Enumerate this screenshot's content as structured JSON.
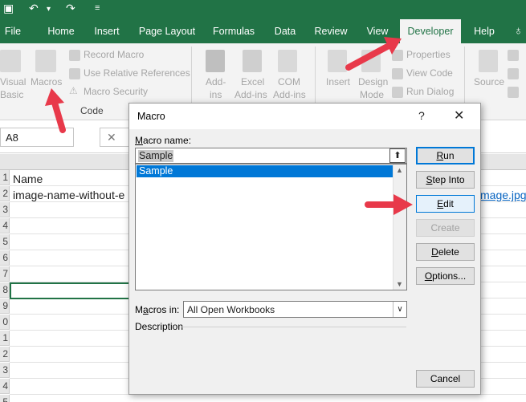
{
  "qat": {
    "undo_icon": "undo-icon",
    "redo_icon": "redo-icon"
  },
  "tabs": [
    "File",
    "Home",
    "Insert",
    "Page Layout",
    "Formulas",
    "Data",
    "Review",
    "View",
    "Developer",
    "Help"
  ],
  "ribbon": {
    "visual_basic": [
      "Visual",
      "Basic"
    ],
    "macros": "Macros",
    "record_macro": "Record Macro",
    "use_relative": "Use Relative References",
    "macro_security": "Macro Security",
    "code_group": "Code",
    "addins": [
      "Add-",
      "ins"
    ],
    "excel_addins": [
      "Excel",
      "Add-ins"
    ],
    "com_addins": [
      "COM",
      "Add-ins"
    ],
    "insert": "Insert",
    "design_mode": [
      "Design",
      "Mode"
    ],
    "properties": "Properties",
    "view_code": "View Code",
    "run_dialog": "Run Dialog",
    "source": "Source"
  },
  "formula_bar": {
    "name_box": "A8",
    "cancel": "✕"
  },
  "grid": {
    "header_name": "Name",
    "row2_text": "image-name-without-e",
    "row2_right": "mage.jpg",
    "row_numbers": [
      "",
      "1",
      "2",
      "3",
      "4",
      "5",
      "6",
      "7",
      "8",
      "9",
      "0",
      "1",
      "2",
      "3",
      "4",
      "5"
    ]
  },
  "dialog": {
    "title": "Macro",
    "help": "?",
    "close": "✕",
    "macro_name_label": "Macro name:",
    "macro_name_value": "Sample",
    "list_items": [
      "Sample"
    ],
    "macros_in_label": "Macros in:",
    "macros_in_value": "All Open Workbooks",
    "description_label": "Description",
    "buttons": {
      "run": "Run",
      "step_into": "Step Into",
      "edit": "Edit",
      "create": "Create",
      "delete": "Delete",
      "options": "Options...",
      "cancel": "Cancel"
    }
  },
  "colors": {
    "excel_green": "#217346",
    "accent_blue": "#0078d7",
    "arrow_red": "#e8394a"
  }
}
